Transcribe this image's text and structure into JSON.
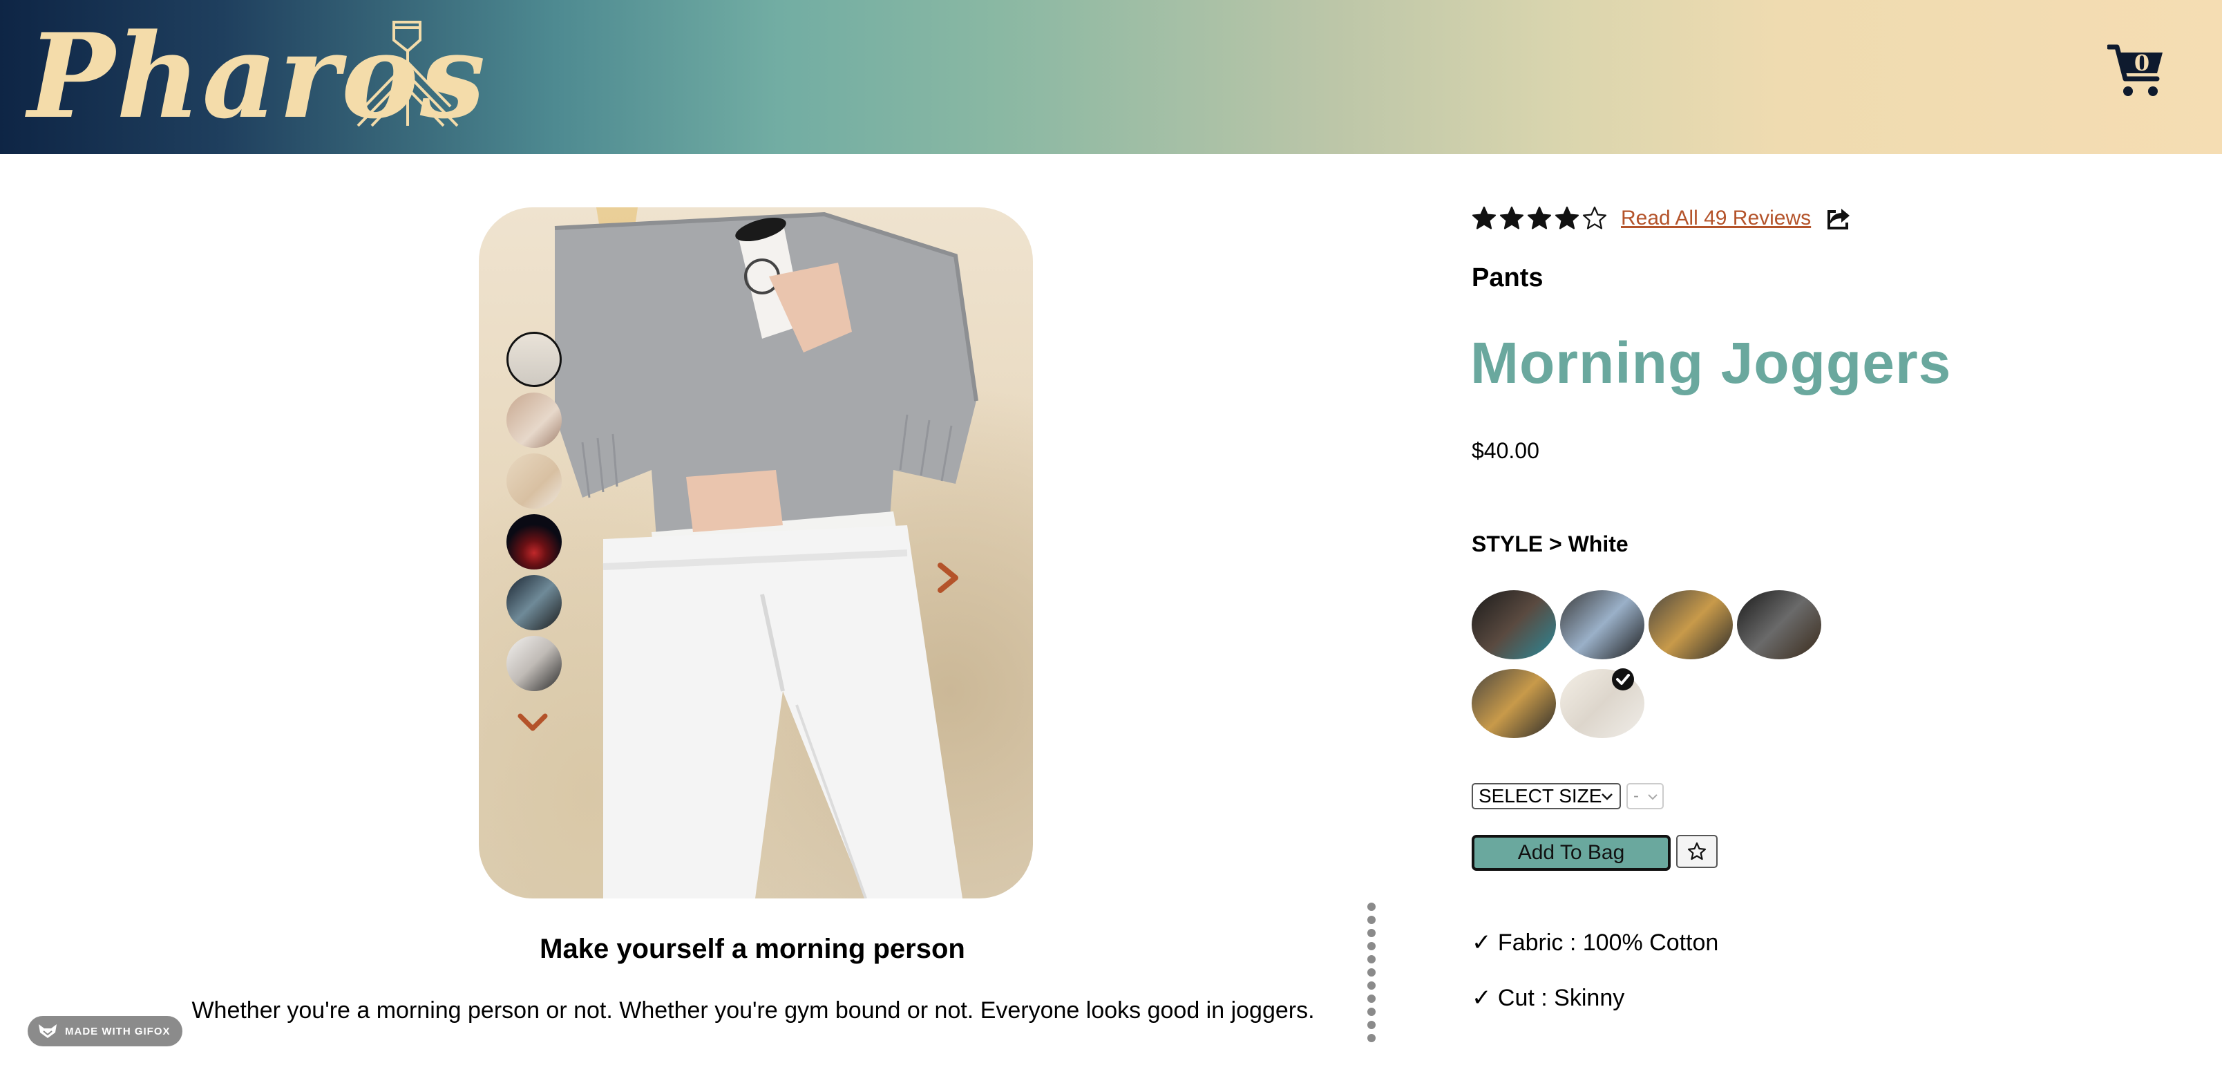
{
  "header": {
    "logo_text": "Pharos",
    "cart_count": "0",
    "colors": {
      "gradient_start": "#0e2545",
      "gradient_end": "#f5ddb3",
      "logo": "#f4dcaa"
    }
  },
  "gallery": {
    "thumbnail_count": 6,
    "active_thumbnail": 1,
    "icons": {
      "down": "chevron-down-icon",
      "next": "chevron-right-icon"
    },
    "accent": "#b4532a"
  },
  "description": {
    "title": "Make yourself a morning person",
    "body": "Whether you're a morning person or not. Whether you're gym bound or not. Everyone looks good in joggers."
  },
  "product": {
    "rating": 4,
    "rating_max": 5,
    "reviews_link": "Read All 49 Reviews",
    "category": "Pants",
    "name": "Morning Joggers",
    "price": "$40.00",
    "style_label": "STYLE > White",
    "selected_style_index": 6,
    "size_select": {
      "selected": "SELECT SIZE"
    },
    "qty_select": {
      "selected": "-"
    },
    "add_to_bag": "Add To Bag",
    "features": [
      "✓ Fabric : 100% Cotton",
      "✓ Cut : Skinny"
    ],
    "accent_color": "#6aa89e"
  },
  "badge": {
    "text": "MADE WITH GIFOX"
  }
}
